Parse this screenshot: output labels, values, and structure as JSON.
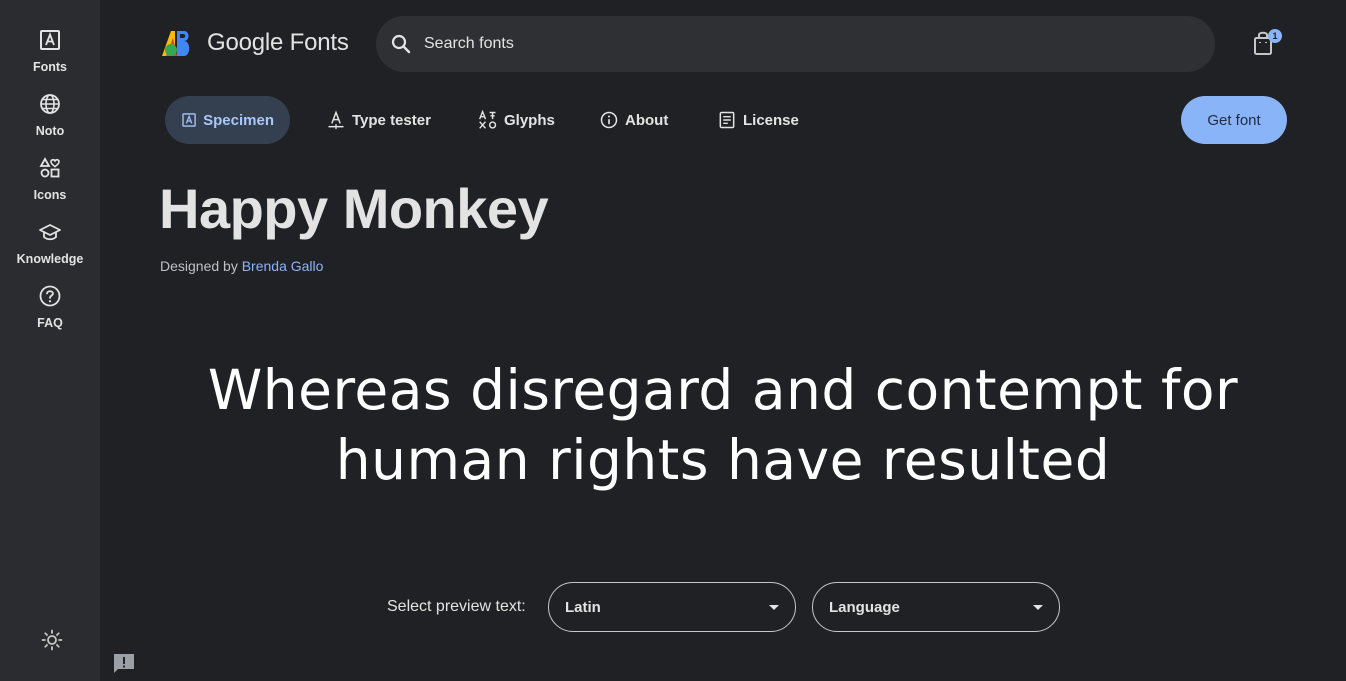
{
  "rail": {
    "items": [
      {
        "label": "Fonts",
        "icon": "font-icon"
      },
      {
        "label": "Noto",
        "icon": "globe-icon"
      },
      {
        "label": "Icons",
        "icon": "shapes-icon"
      },
      {
        "label": "Knowledge",
        "icon": "school-icon"
      },
      {
        "label": "FAQ",
        "icon": "help-icon"
      }
    ]
  },
  "header": {
    "logo_text": "Google Fonts",
    "search_placeholder": "Search fonts",
    "cart_count": "1"
  },
  "tabs": [
    {
      "label": "Specimen",
      "active": true
    },
    {
      "label": "Type tester",
      "active": false
    },
    {
      "label": "Glyphs",
      "active": false
    },
    {
      "label": "About",
      "active": false
    },
    {
      "label": "License",
      "active": false
    }
  ],
  "get_font_label": "Get font",
  "font": {
    "name": "Happy Monkey",
    "designed_by_prefix": "Designed by",
    "designer": "Brenda Gallo"
  },
  "preview": {
    "line1": "Whereas disregard and contempt for",
    "line2": "human rights have resulted"
  },
  "controls": {
    "select_label": "Select preview text:",
    "script_value": "Latin",
    "language_value": "Language"
  },
  "colors": {
    "background": "#202124",
    "rail": "#2b2c2f",
    "accent": "#8ab4f8",
    "active_tab": "#34404f"
  }
}
